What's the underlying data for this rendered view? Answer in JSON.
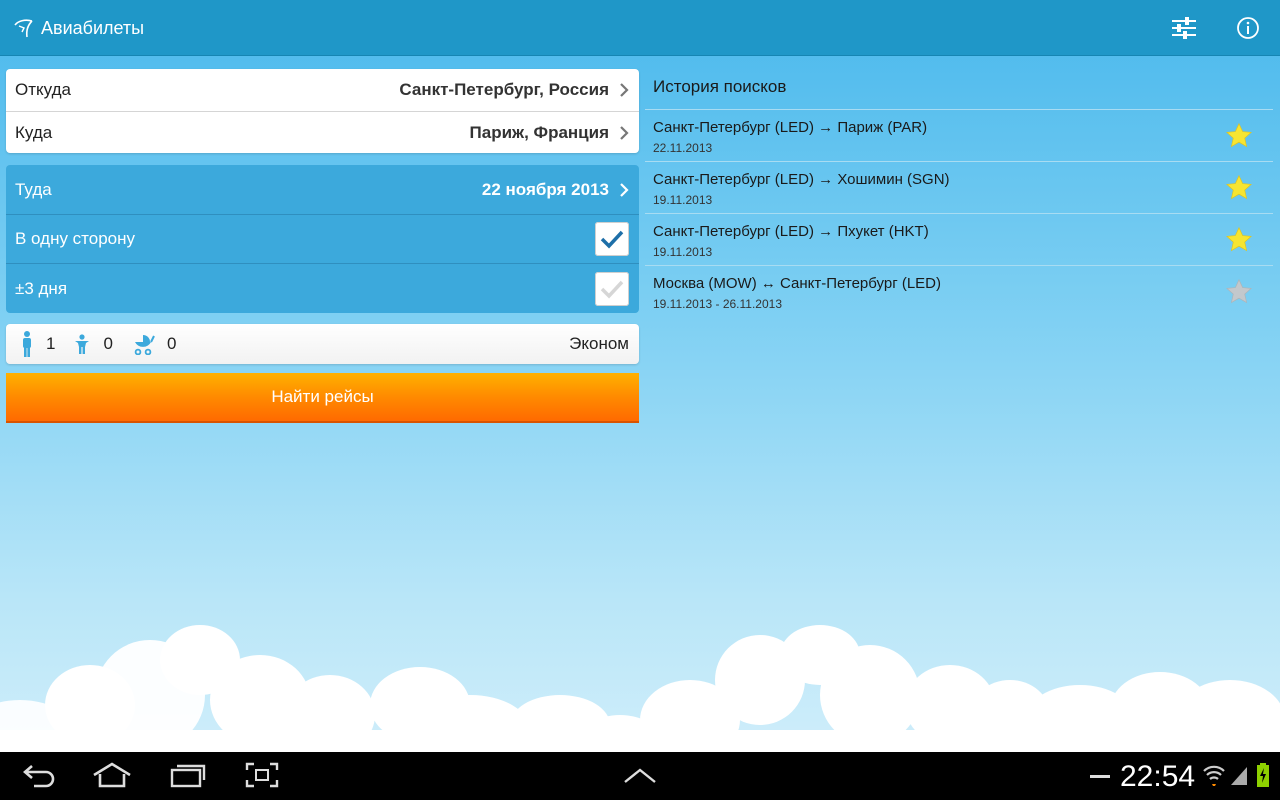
{
  "app": {
    "title": "Авиабилеты",
    "icons": {
      "logo": "plane-logo-icon",
      "settings": "sliders-icon",
      "info": "info-icon"
    }
  },
  "route": {
    "from_label": "Откуда",
    "from_value": "Санкт-Петербург, Россия",
    "to_label": "Куда",
    "to_value": "Париж, Франция"
  },
  "options": {
    "depart_label": "Туда",
    "depart_value": "22 ноября 2013",
    "oneway_label": "В одну сторону",
    "oneway_checked": true,
    "flex_label": "±3 дня",
    "flex_checked": false
  },
  "passengers": {
    "adults": "1",
    "children": "0",
    "infants": "0",
    "class": "Эконом"
  },
  "search_button": "Найти рейсы",
  "history": {
    "title": "История поисков",
    "items": [
      {
        "route": "Санкт-Петербург (LED) → Париж (PAR)",
        "date": "22.11.2013",
        "favorite": true
      },
      {
        "route": "Санкт-Петербург (LED) → Хошимин (SGN)",
        "date": "19.11.2013",
        "favorite": true
      },
      {
        "route": "Санкт-Петербург (LED) → Пхукет (HKT)",
        "date": "19.11.2013",
        "favorite": true
      },
      {
        "route": "Москва (MOW) ↔ Санкт-Петербург (LED)",
        "date": "19.11.2013 - 26.11.2013",
        "favorite": false
      }
    ]
  },
  "colors": {
    "actionbar": "#1f97c8",
    "card_blue": "#3ca9dc",
    "star_on": "#f7e531",
    "star_off": "#c3c8cc",
    "button_orange": "#ff8a00"
  },
  "system": {
    "clock": "22:54"
  }
}
